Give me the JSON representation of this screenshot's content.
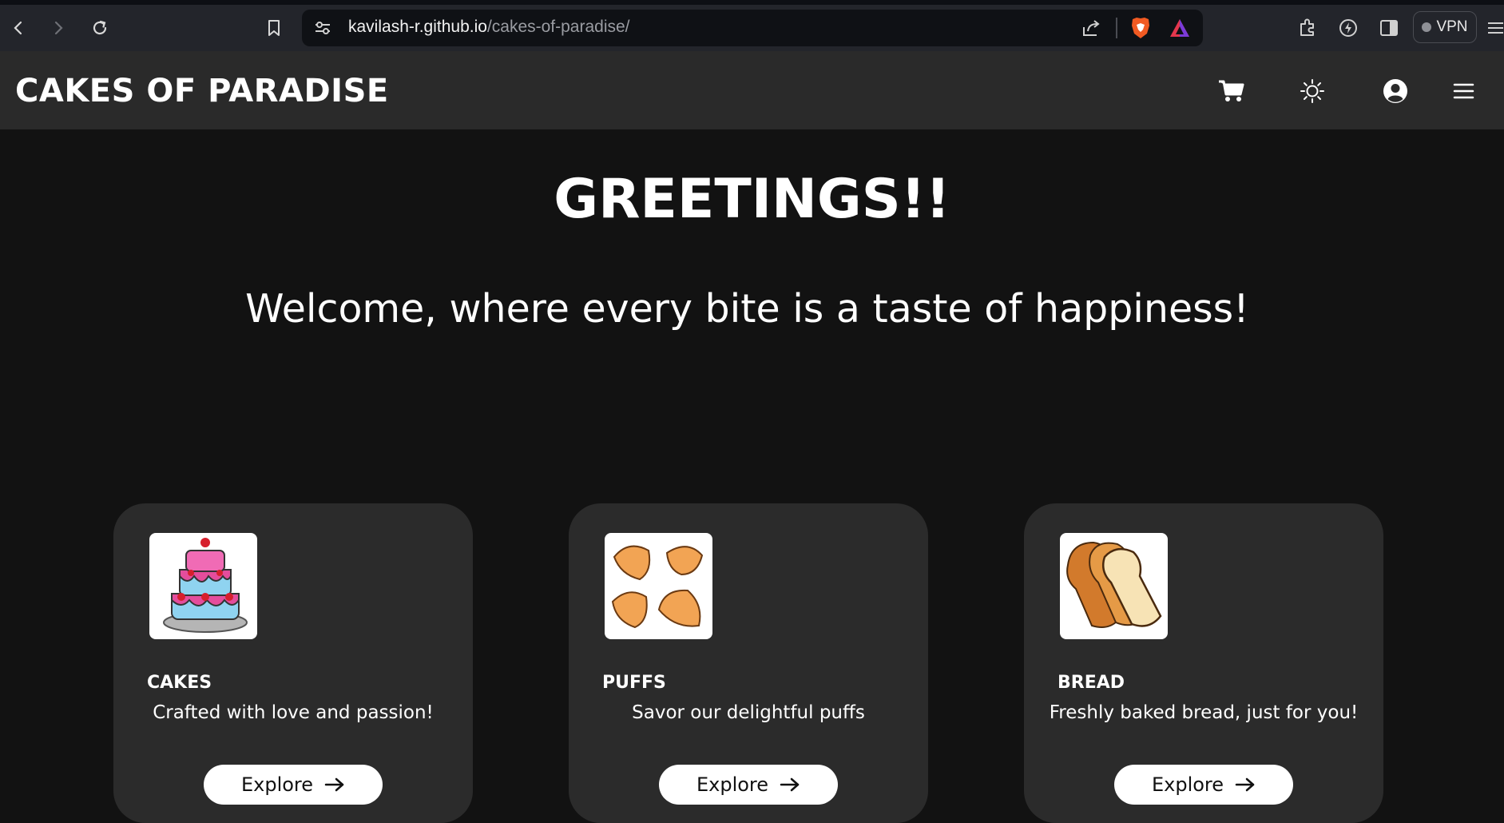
{
  "browser": {
    "url_host": "kavilash-r.github.io",
    "url_path": "/cakes-of-paradise/",
    "vpn_label": "VPN",
    "icons": [
      "back-icon",
      "forward-icon",
      "reload-icon",
      "bookmark-icon",
      "site-settings-icon",
      "share-icon",
      "brave-shield-icon",
      "brave-rewards-icon",
      "extensions-icon",
      "leo-icon",
      "sidebar-icon",
      "menu-icon"
    ]
  },
  "site": {
    "brand": "CAKES OF PARADISE",
    "header_icons": [
      "cart-icon",
      "theme-sun-icon",
      "user-icon",
      "hamburger-icon"
    ]
  },
  "hero": {
    "title": "GREETINGS!!",
    "subtitle": "Welcome, where every bite is a taste of happiness!"
  },
  "cards": [
    {
      "title": "CAKES",
      "description": "Crafted with love and passion!",
      "button": "Explore",
      "image_icon": "cake-icon"
    },
    {
      "title": "PUFFS",
      "description": "Savor our delightful puffs",
      "button": "Explore",
      "image_icon": "puffs-icon"
    },
    {
      "title": "BREAD",
      "description": "Freshly baked bread, just for you!",
      "button": "Explore",
      "image_icon": "bread-icon"
    }
  ],
  "colors": {
    "page_bg": "#121212",
    "header_bg": "#2a2a2a",
    "card_bg": "#2b2b2b",
    "text": "#ffffff",
    "button_bg": "#ffffff"
  }
}
